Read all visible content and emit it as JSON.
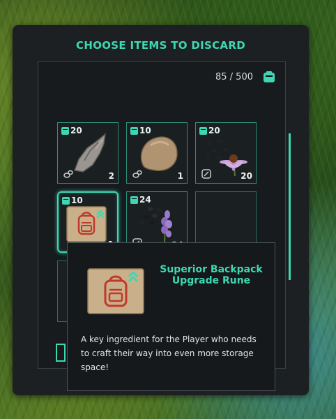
{
  "panel": {
    "title": "CHOOSE ITEMS TO DISCARD"
  },
  "capacity": {
    "text": "85 / 500"
  },
  "slots": [
    {
      "badge": "20",
      "qty": "2"
    },
    {
      "badge": "10",
      "qty": "1"
    },
    {
      "badge": "20",
      "qty": "20"
    },
    {
      "badge": "10",
      "qty": "1"
    },
    {
      "badge": "24",
      "qty": "24"
    }
  ],
  "tooltip": {
    "name": "Superior Backpack Upgrade Rune",
    "description": "A key ingredient for the Player who needs to craft their way into even more storage space!"
  },
  "colors": {
    "accent": "#3fd7b3",
    "panel": "#1c2023",
    "rune": "#c9b08a",
    "rune_mark": "#c0392b"
  }
}
